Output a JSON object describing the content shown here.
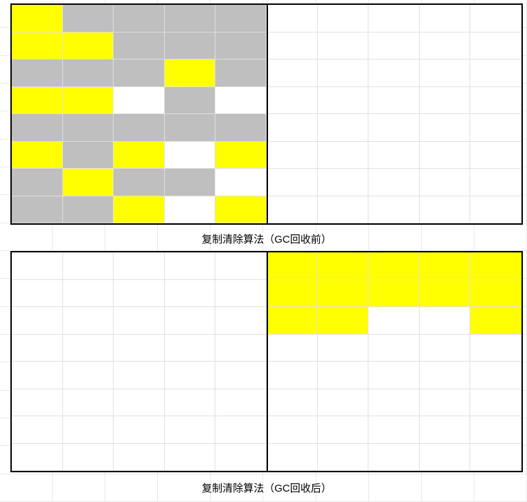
{
  "diagram": {
    "caption_before": "复制清除算法（GC回收前）",
    "caption_after": "复制清除算法（GC回收后）",
    "colors": {
      "live": "#ffff00",
      "dead": "#bfbfbf",
      "empty": "#ffffff"
    },
    "grid_before": {
      "rows": 8,
      "cols": 10,
      "left_half": [
        [
          "yellow",
          "gray",
          "gray",
          "gray",
          "gray"
        ],
        [
          "yellow",
          "yellow",
          "gray",
          "gray",
          "gray"
        ],
        [
          "gray",
          "gray",
          "gray",
          "yellow",
          "gray"
        ],
        [
          "yellow",
          "yellow",
          "white",
          "gray",
          "white"
        ],
        [
          "gray",
          "gray",
          "gray",
          "gray",
          "gray"
        ],
        [
          "yellow",
          "gray",
          "yellow",
          "white",
          "yellow"
        ],
        [
          "gray",
          "yellow",
          "gray",
          "gray",
          "white"
        ],
        [
          "gray",
          "gray",
          "yellow",
          "white",
          "yellow"
        ]
      ],
      "right_half_fill": "white"
    },
    "grid_after": {
      "rows": 8,
      "cols": 10,
      "left_half_fill": "white",
      "right_half": [
        [
          "yellow",
          "yellow",
          "yellow",
          "yellow",
          "yellow"
        ],
        [
          "yellow",
          "yellow",
          "yellow",
          "yellow",
          "yellow"
        ],
        [
          "yellow",
          "yellow",
          "white",
          "white",
          "yellow"
        ],
        [
          "white",
          "white",
          "white",
          "white",
          "white"
        ],
        [
          "white",
          "white",
          "white",
          "white",
          "white"
        ],
        [
          "white",
          "white",
          "white",
          "white",
          "white"
        ],
        [
          "white",
          "white",
          "white",
          "white",
          "white"
        ],
        [
          "white",
          "white",
          "white",
          "white",
          "white"
        ]
      ]
    }
  }
}
